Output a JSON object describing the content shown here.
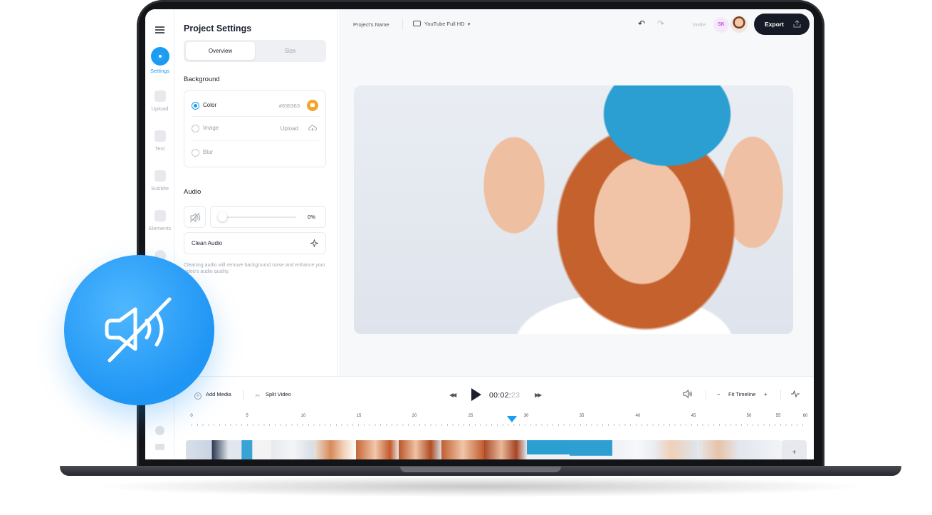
{
  "rail": {
    "items": [
      {
        "label": "Settings",
        "icon": "settings-icon"
      },
      {
        "label": "Upload",
        "icon": "upload-icon"
      },
      {
        "label": "Text",
        "icon": "text-icon"
      },
      {
        "label": "Subtitle",
        "icon": "subtitle-icon"
      },
      {
        "label": "Elements",
        "icon": "elements-icon"
      }
    ]
  },
  "panel": {
    "title": "Project Settings",
    "tabs": [
      "Overview",
      "Size"
    ],
    "background_label": "Background",
    "options": {
      "color_label": "Color",
      "color_value": "#636363",
      "image_label": "Image",
      "upload_label": "Upload",
      "blur_label": "Blur"
    },
    "audio_label": "Audio",
    "volume": "0%",
    "clean_audio_label": "Clean Audio",
    "note": "Cleaning audio will remove background noise and enhance your video's audio quality."
  },
  "topbar": {
    "project_name": "Project's Name",
    "format": "YouTube Full HD",
    "invite": "Invite",
    "avatar_initials": "SK",
    "export_label": "Export"
  },
  "timeline": {
    "add_media": "Add Media",
    "split_video": "Split Video",
    "time_main": "00:02:",
    "time_frames": "23",
    "fit_timeline": "Fit Timeline",
    "ticks": [
      "0",
      "5",
      "10",
      "15",
      "20",
      "25",
      "30",
      "35",
      "40",
      "45",
      "50",
      "55",
      "60"
    ],
    "add_clip": "+"
  },
  "colors": {
    "accent": "#1b9cf3",
    "export_bg": "#161a27",
    "picker": "#f4a52c"
  }
}
